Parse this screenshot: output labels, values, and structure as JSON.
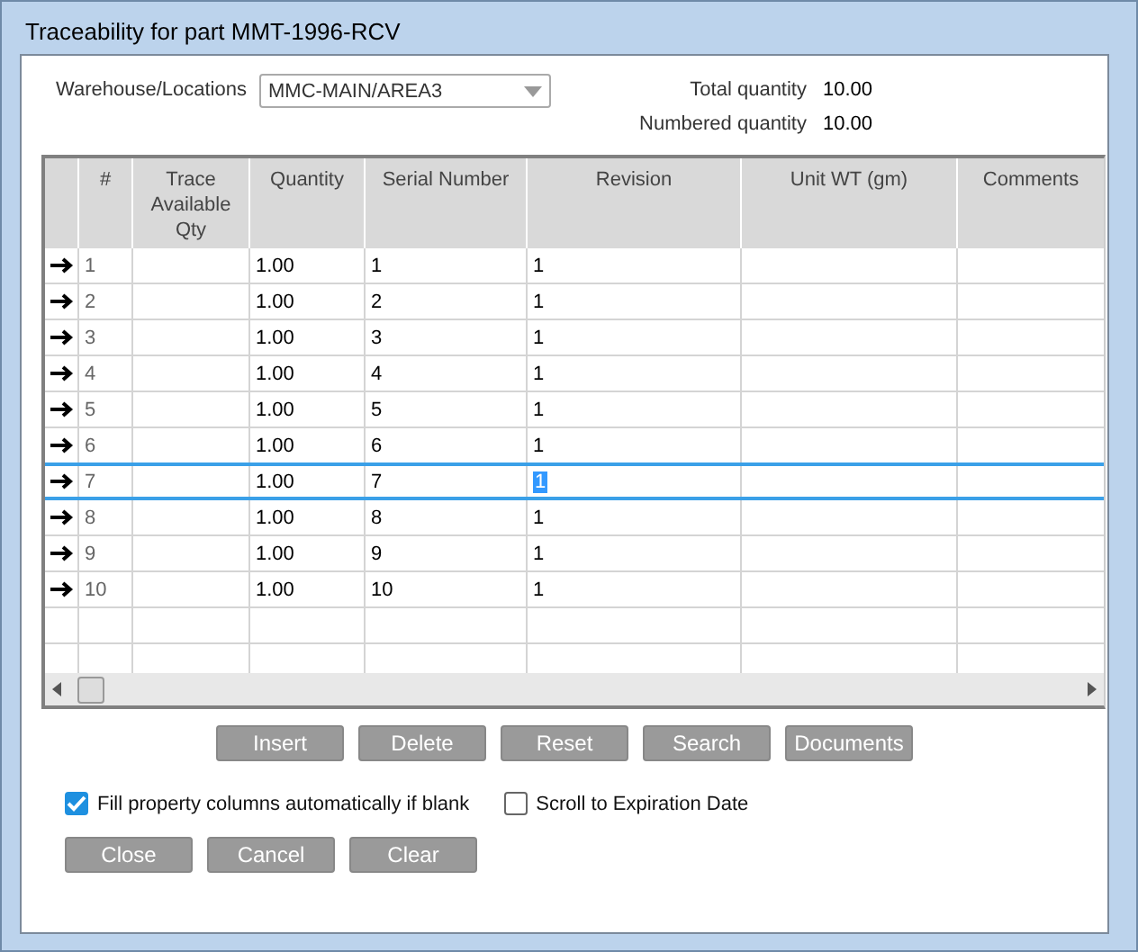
{
  "window": {
    "title": "Traceability for part MMT-1996-RCV"
  },
  "location": {
    "label": "Warehouse/Locations",
    "value": "MMC-MAIN/AREA3"
  },
  "totals": [
    {
      "label": "Total quantity",
      "value": "10.00"
    },
    {
      "label": "Numbered quantity",
      "value": "10.00"
    }
  ],
  "table": {
    "columns": [
      "#",
      "Trace Available Qty",
      "Quantity",
      "Serial Number",
      "Revision",
      "Unit WT (gm)",
      "Comments"
    ],
    "rows": [
      {
        "num": "1",
        "quantity": "1.00",
        "serial": "1",
        "revision": "1",
        "selected": false
      },
      {
        "num": "2",
        "quantity": "1.00",
        "serial": "2",
        "revision": "1",
        "selected": false
      },
      {
        "num": "3",
        "quantity": "1.00",
        "serial": "3",
        "revision": "1",
        "selected": false
      },
      {
        "num": "4",
        "quantity": "1.00",
        "serial": "4",
        "revision": "1",
        "selected": false
      },
      {
        "num": "5",
        "quantity": "1.00",
        "serial": "5",
        "revision": "1",
        "selected": false
      },
      {
        "num": "6",
        "quantity": "1.00",
        "serial": "6",
        "revision": "1",
        "selected": false
      },
      {
        "num": "7",
        "quantity": "1.00",
        "serial": "7",
        "revision": "1",
        "selected": true
      },
      {
        "num": "8",
        "quantity": "1.00",
        "serial": "8",
        "revision": "1",
        "selected": false
      },
      {
        "num": "9",
        "quantity": "1.00",
        "serial": "9",
        "revision": "1",
        "selected": false
      },
      {
        "num": "10",
        "quantity": "1.00",
        "serial": "10",
        "revision": "1",
        "selected": false
      }
    ]
  },
  "grid_buttons": [
    "Insert",
    "Delete",
    "Reset",
    "Search",
    "Documents"
  ],
  "options": [
    {
      "label": "Fill property columns automatically if blank",
      "checked": true
    },
    {
      "label": "Scroll to Expiration Date",
      "checked": false
    }
  ],
  "buttons": [
    "Close",
    "Cancel",
    "Clear"
  ]
}
